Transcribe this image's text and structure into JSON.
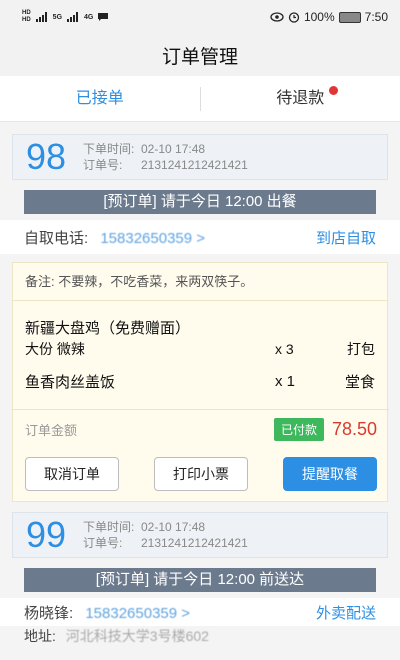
{
  "status_bar": {
    "left_hd1": "HD",
    "left_hd2": "HD",
    "net1": "5G",
    "net2": "4G",
    "battery_pct": "100%",
    "time": "7:50"
  },
  "header": {
    "title": "订单管理"
  },
  "tabs": [
    {
      "label": "已接单",
      "active": true
    },
    {
      "label": "待退款",
      "active": false,
      "has_badge": true
    }
  ],
  "orders": [
    {
      "number": "98",
      "time_label": "下单时间:",
      "time_value": "02-10  17:48",
      "id_label": "订单号:",
      "id_value": "2131241212421421",
      "banner": "[预订单] 请于今日 12:00 出餐",
      "contact_label": "自取电话:",
      "contact_value": "15832650359 >",
      "delivery_mode": "到店自取",
      "note": "备注: 不要辣，不吃香菜，来两双筷子。",
      "items": [
        {
          "name": "新疆大盘鸡（免费赠面）",
          "spec": "大份  微辣",
          "qty": "x 3",
          "pack": "打包"
        },
        {
          "name": "鱼香肉丝盖饭",
          "qty": "x 1",
          "pack": "堂食"
        }
      ],
      "amount_label": "订单金额",
      "paid_status": "已付款",
      "amount": "78.50",
      "actions": {
        "cancel": "取消订单",
        "print": "打印小票",
        "remind": "提醒取餐"
      }
    },
    {
      "number": "99",
      "time_label": "下单时间:",
      "time_value": "02-10  17:48",
      "id_label": "订单号:",
      "id_value": "2131241212421421",
      "banner": "[预订单] 请于今日 12:00 前送达",
      "contact_label": "杨晓锋:",
      "contact_value": "15832650359 >",
      "delivery_mode": "外卖配送",
      "address_label": "地址:",
      "address_value": "河北科技大学3号楼602"
    }
  ]
}
